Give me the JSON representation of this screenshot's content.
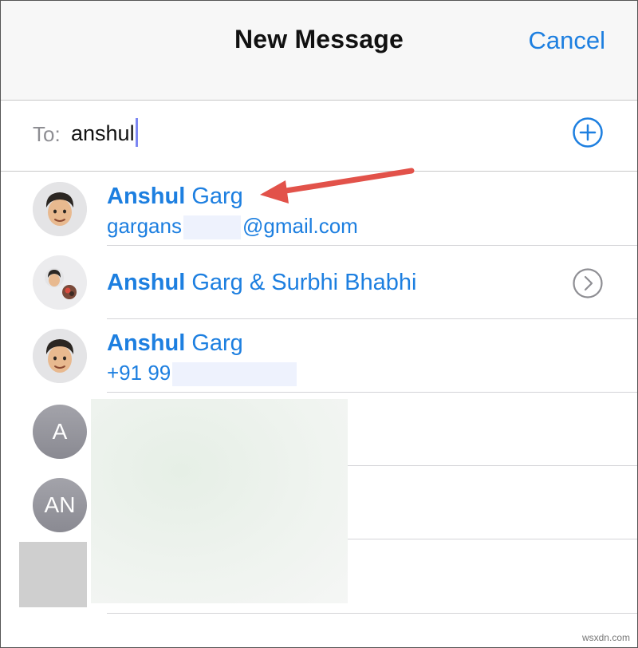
{
  "header": {
    "title": "New Message",
    "cancel_label": "Cancel"
  },
  "to_field": {
    "label": "To:",
    "value": "anshul"
  },
  "contacts": [
    {
      "name_bold": "Anshul",
      "name_rest": " Garg",
      "detail_prefix": "gargans",
      "detail_suffix": "@gmail.com"
    },
    {
      "name_bold": "Anshul",
      "name_rest": " Garg & Surbhi Bhabhi"
    },
    {
      "name_bold": "Anshul",
      "name_rest": " Garg",
      "detail_prefix": "+91 99",
      "detail_suffix": ""
    },
    {
      "initials": "A"
    },
    {
      "initials": "AN"
    }
  ],
  "watermark": "wsxdn.com",
  "colors": {
    "accent": "#1d7fe0",
    "arrow": "#e2524a",
    "separator": "#d4d4d8"
  },
  "icons": {
    "add": "plus-circle-icon",
    "group_chevron": "chevron-right-circle-icon",
    "annotation": "red-arrow-annotation"
  }
}
